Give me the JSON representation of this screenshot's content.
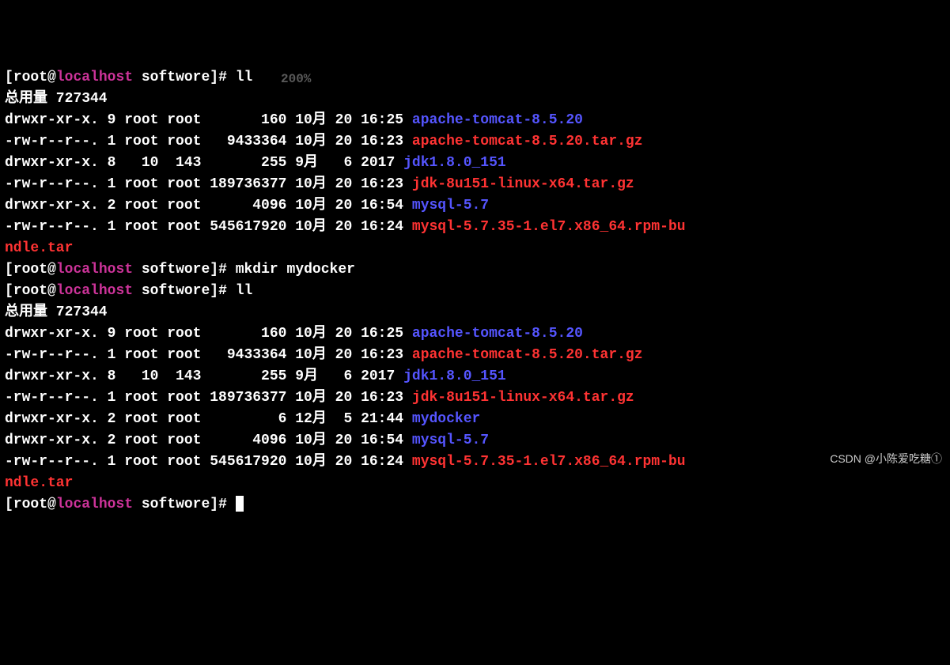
{
  "prompt": {
    "open": "[",
    "user": "root",
    "at": "@",
    "host": "localhost",
    "space": " ",
    "dir": "softwore",
    "close": "]# "
  },
  "cmds": {
    "ll1": "ll",
    "mkdir": "mkdir mydocker",
    "ll2": "ll"
  },
  "total1": "总用量 727344",
  "total2": "总用量 727344",
  "list1": [
    {
      "perm": "drwxr-xr-x. 9 root root       160 10月 20 16:25 ",
      "name": "apache-tomcat-8.5.20",
      "cls": "dir-blue"
    },
    {
      "perm": "-rw-r--r--. 1 root root   9433364 10月 20 16:23 ",
      "name": "apache-tomcat-8.5.20.tar.gz",
      "cls": "file-red"
    },
    {
      "perm": "drwxr-xr-x. 8   10  143       255 9月   6 2017 ",
      "name": "jdk1.8.0_151",
      "cls": "dir-blue"
    },
    {
      "perm": "-rw-r--r--. 1 root root 189736377 10月 20 16:23 ",
      "name": "jdk-8u151-linux-x64.tar.gz",
      "cls": "file-red"
    },
    {
      "perm": "drwxr-xr-x. 2 root root      4096 10月 20 16:54 ",
      "name": "mysql-5.7",
      "cls": "dir-blue"
    },
    {
      "perm": "-rw-r--r--. 1 root root 545617920 10月 20 16:24 ",
      "name": "mysql-5.7.35-1.el7.x86_64.rpm-bu",
      "cls": "file-red"
    }
  ],
  "cont1": "ndle.tar",
  "list2": [
    {
      "perm": "drwxr-xr-x. 9 root root       160 10月 20 16:25 ",
      "name": "apache-tomcat-8.5.20",
      "cls": "dir-blue"
    },
    {
      "perm": "-rw-r--r--. 1 root root   9433364 10月 20 16:23 ",
      "name": "apache-tomcat-8.5.20.tar.gz",
      "cls": "file-red"
    },
    {
      "perm": "drwxr-xr-x. 8   10  143       255 9月   6 2017 ",
      "name": "jdk1.8.0_151",
      "cls": "dir-blue"
    },
    {
      "perm": "-rw-r--r--. 1 root root 189736377 10月 20 16:23 ",
      "name": "jdk-8u151-linux-x64.tar.gz",
      "cls": "file-red"
    },
    {
      "perm": "drwxr-xr-x. 2 root root         6 12月  5 21:44 ",
      "name": "mydocker",
      "cls": "dir-blue"
    },
    {
      "perm": "drwxr-xr-x. 2 root root      4096 10月 20 16:54 ",
      "name": "mysql-5.7",
      "cls": "dir-blue"
    },
    {
      "perm": "-rw-r--r--. 1 root root 545617920 10月 20 16:24 ",
      "name": "mysql-5.7.35-1.el7.x86_64.rpm-bu",
      "cls": "file-red"
    }
  ],
  "cont2": "ndle.tar",
  "ghost": "200%",
  "watermark": "CSDN @小陈爱吃糖①"
}
